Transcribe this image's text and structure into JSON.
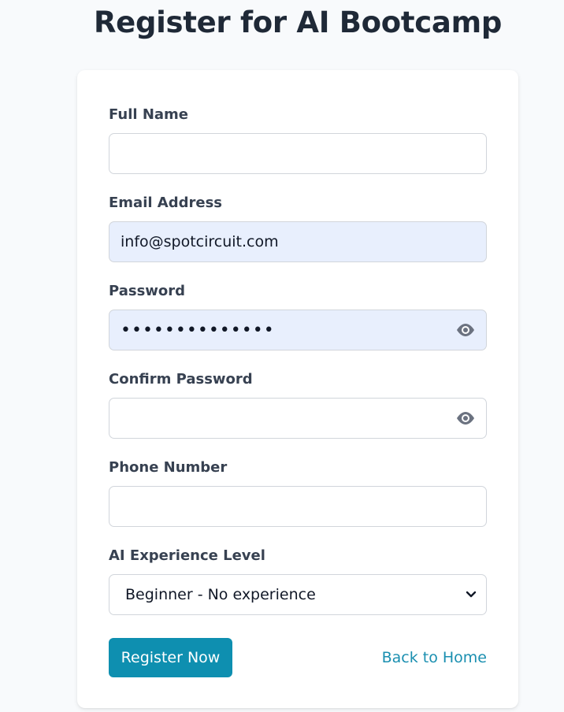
{
  "page": {
    "title": "Register for AI Bootcamp"
  },
  "form": {
    "full_name": {
      "label": "Full Name",
      "value": ""
    },
    "email": {
      "label": "Email Address",
      "value": "info@spotcircuit.com"
    },
    "password": {
      "label": "Password",
      "value": "••••••••••••••"
    },
    "confirm_password": {
      "label": "Confirm Password",
      "value": ""
    },
    "phone": {
      "label": "Phone Number",
      "value": ""
    },
    "experience": {
      "label": "AI Experience Level",
      "selected": "Beginner - No experience"
    },
    "submit_label": "Register Now",
    "back_label": "Back to Home"
  },
  "icons": {
    "password_toggle": "eye-icon",
    "confirm_toggle": "eye-icon",
    "select_arrow": "chevron-down-icon"
  },
  "colors": {
    "accent": "#0e8fb0",
    "link": "#1a8fb0",
    "autofill_bg": "#e8effd",
    "page_bg": "#f8fafc"
  }
}
